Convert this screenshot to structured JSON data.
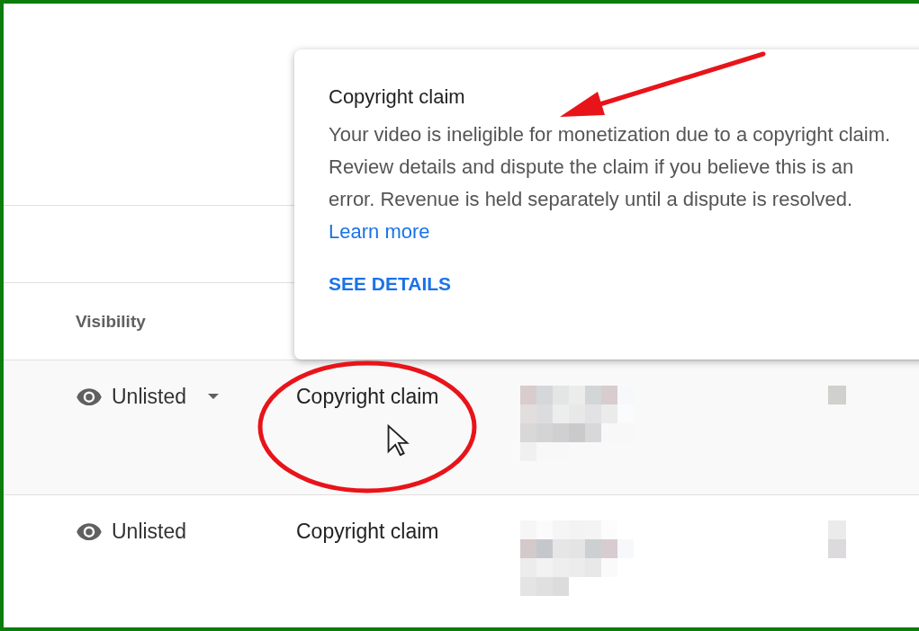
{
  "popup": {
    "title": "Copyright claim",
    "paragraphs": [
      "Your video is ineligible for monetization due to a copyright claim.",
      "Review details and dispute the claim if you believe this is an error. Revenue is held separately until a dispute is resolved."
    ],
    "link": "Learn more",
    "action": "SEE DETAILS"
  },
  "table": {
    "columns": [
      {
        "label": "Visibility"
      }
    ],
    "rows": [
      {
        "visibility": "Unlisted",
        "has_menu": true,
        "hovered": true,
        "restrictions": "Copyright claim"
      },
      {
        "visibility": "Unlisted",
        "has_menu": false,
        "hovered": false,
        "restrictions": "Copyright claim"
      }
    ]
  }
}
